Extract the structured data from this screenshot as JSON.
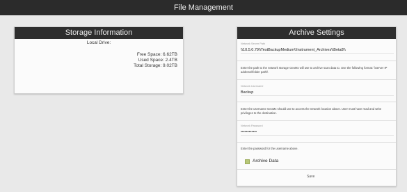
{
  "window": {
    "title": "File Management"
  },
  "storage": {
    "header": "Storage Information",
    "drive_label": "Local Drive:",
    "free_space": "Free Space: 6.62TB",
    "used_space": "Used Space: 2.4TB",
    "total_storage": "Total Storage: 9.02TB"
  },
  "archive": {
    "header": "Archive Settings",
    "path_label": "Network Server Path",
    "path_value": "\\\\10.5.0.79\\\\TestBackupMedium\\\\Instrument_Archives\\\\Beta8\\\\",
    "path_help": "Enter the path to the network storage GeoMx will use to archive scan data to. Use the following format: \\\\server IP address\\\\folder path\\\\",
    "username_label": "Network Username",
    "username_value": "Backup",
    "username_help": "Enter the username GeoMx should use to access the network location above. User must have read and write privileges to the destination.",
    "password_label": "Network Password",
    "password_value": "••••••••••••",
    "password_help": "Enter the password for the username above.",
    "archive_data_label": "Archive Data",
    "archive_data_checked": true,
    "save_label": "Save"
  }
}
